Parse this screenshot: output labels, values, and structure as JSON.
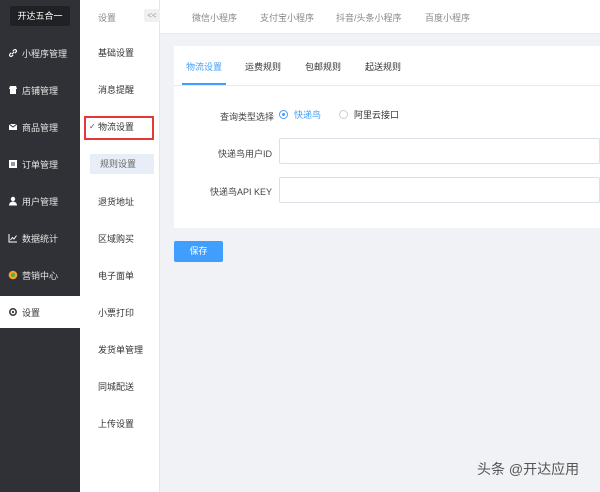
{
  "brand": "开达五合一",
  "sidebar": {
    "items": [
      {
        "label": "小程序管理",
        "icon": "link-icon"
      },
      {
        "label": "店铺管理",
        "icon": "store-icon"
      },
      {
        "label": "商品管理",
        "icon": "box-icon"
      },
      {
        "label": "订单管理",
        "icon": "order-icon"
      },
      {
        "label": "用户管理",
        "icon": "user-icon"
      },
      {
        "label": "数据统计",
        "icon": "chart-icon"
      },
      {
        "label": "营销中心",
        "icon": "marketing-icon"
      },
      {
        "label": "设置",
        "icon": "gear-icon"
      }
    ]
  },
  "submenu": {
    "header": "设置",
    "collapse": "<<",
    "items": [
      "基础设置",
      "消息提醒",
      "物流设置",
      "规则设置",
      "退货地址",
      "区域购买",
      "电子面单",
      "小票打印",
      "发货单管理",
      "同城配送",
      "上传设置"
    ]
  },
  "top_tabs": [
    "微信小程序",
    "支付宝小程序",
    "抖音/头条小程序",
    "百度小程序"
  ],
  "tabs": [
    "物流设置",
    "运费规则",
    "包邮规则",
    "起送规则"
  ],
  "form": {
    "query_type_label": "查询类型选择",
    "radio_options": [
      "快递鸟",
      "阿里云接口"
    ],
    "selected_option": "快递鸟",
    "user_id_label": "快递鸟用户ID",
    "user_id_value": "",
    "api_key_label": "快递鸟API KEY",
    "api_key_value": ""
  },
  "save_label": "保存",
  "watermark": "头条 @开达应用",
  "colors": {
    "accent": "#409eff",
    "sidebar_bg": "#2f3136",
    "highlight_border": "#e53935"
  }
}
